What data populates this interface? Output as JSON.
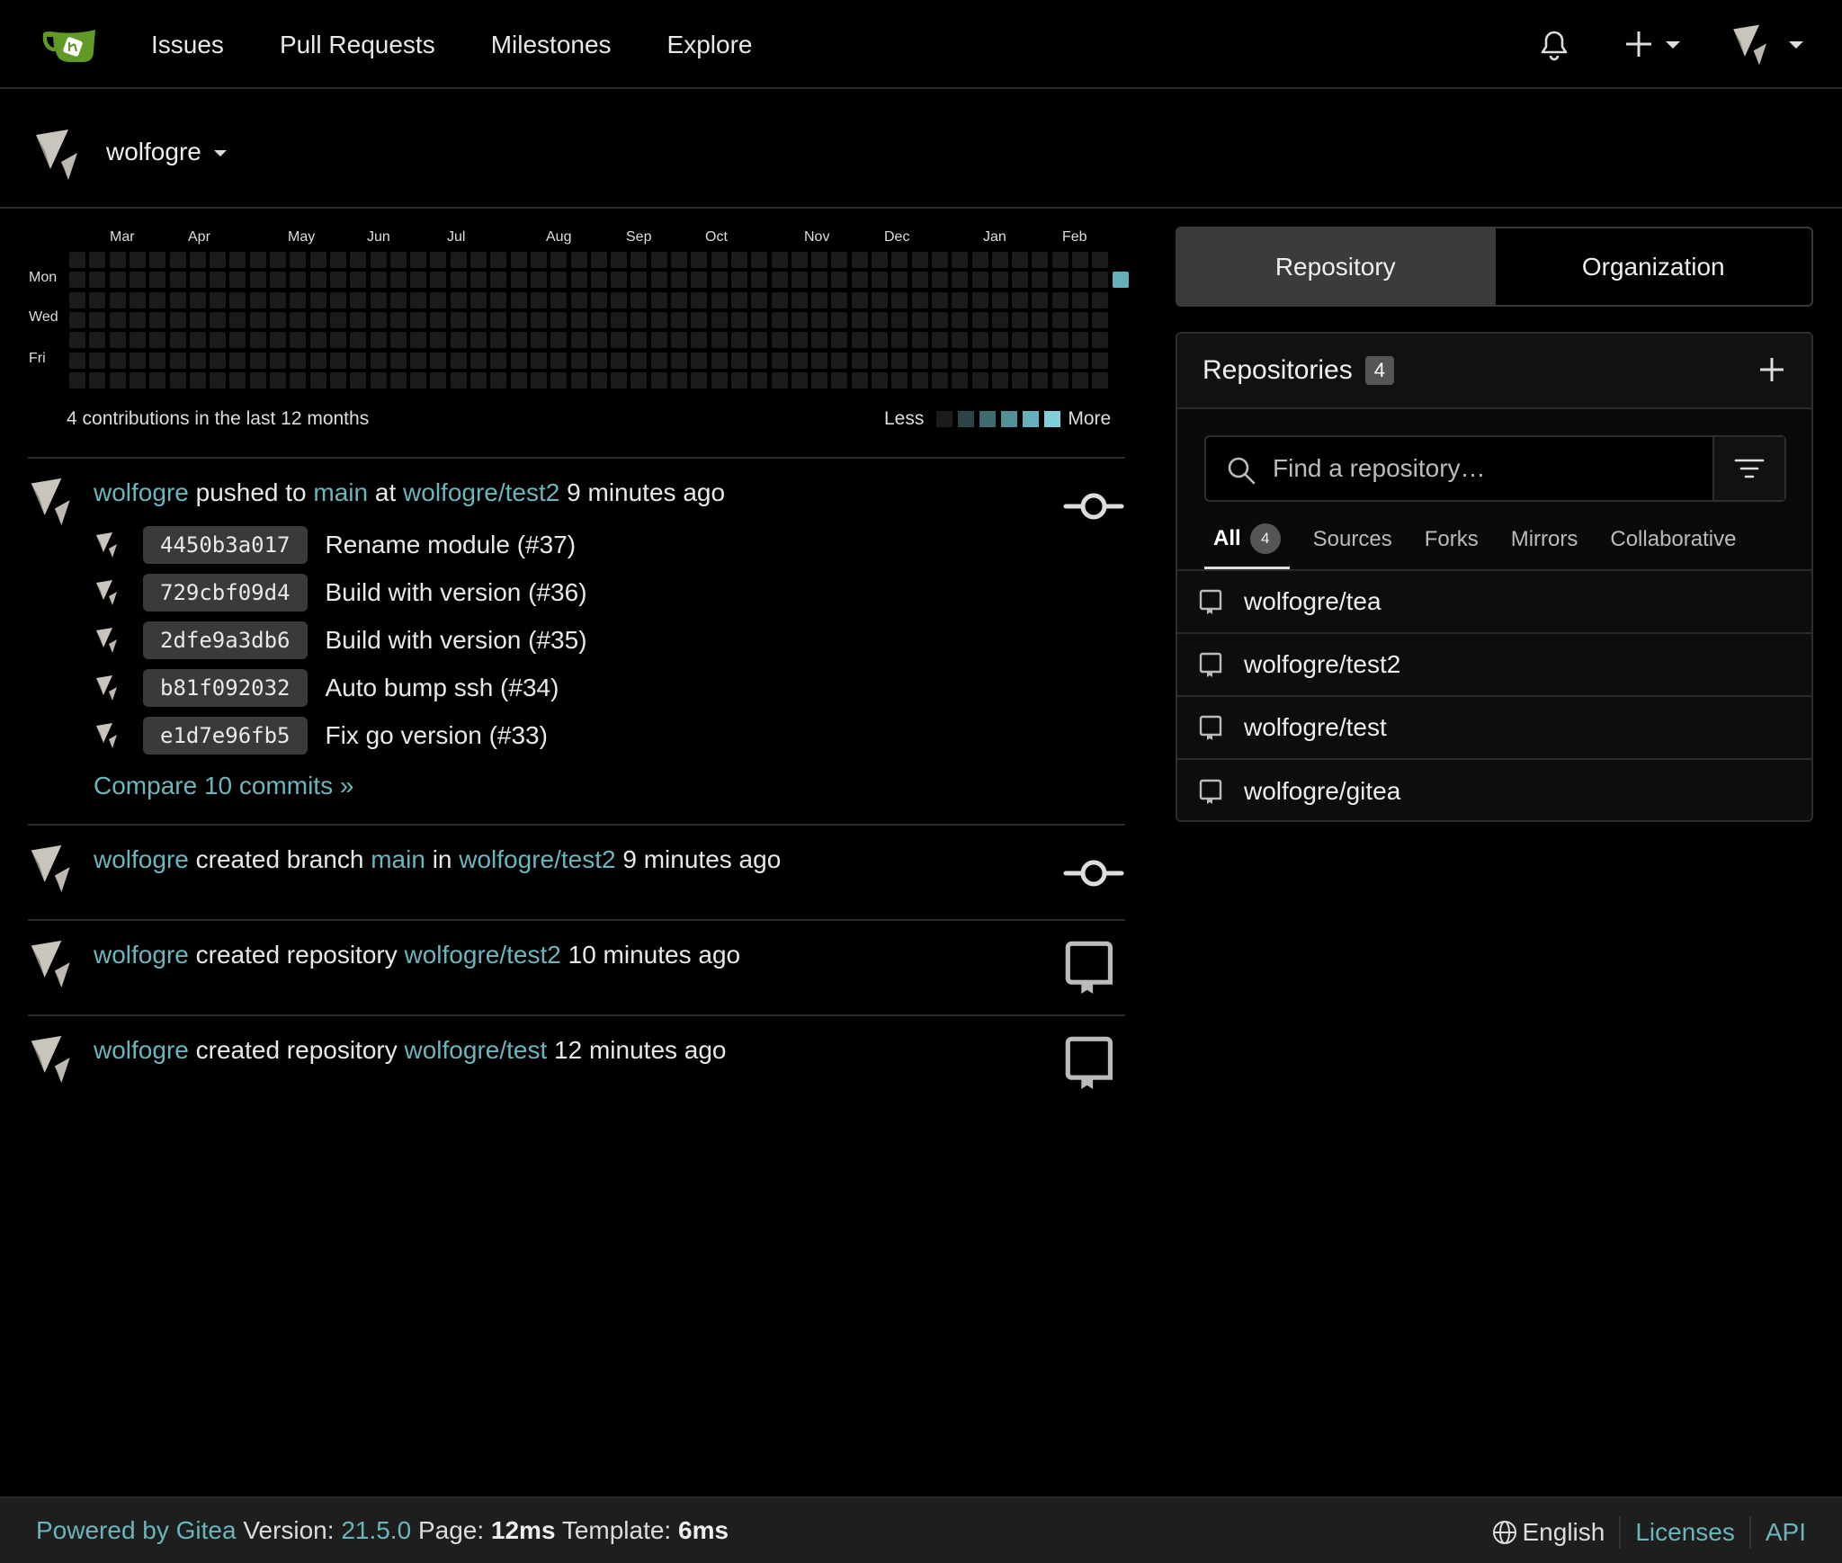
{
  "nav": {
    "links": [
      "Issues",
      "Pull Requests",
      "Milestones",
      "Explore"
    ]
  },
  "context": {
    "user": "wolfogre"
  },
  "heatmap": {
    "months": [
      "Mar",
      "Apr",
      "May",
      "Jun",
      "Jul",
      "Aug",
      "Sep",
      "Oct",
      "Nov",
      "Dec",
      "Jan",
      "Feb"
    ],
    "days": [
      "Mon",
      "Wed",
      "Fri"
    ],
    "summary": "4 contributions in the last 12 months",
    "less": "Less",
    "more": "More",
    "colors": [
      "#1b1b1b",
      "#2c4447",
      "#3f6a6f",
      "#529197",
      "#64b0b8",
      "#7fd0d8"
    ]
  },
  "feed": [
    {
      "user": "wolfogre",
      "verb": "pushed to",
      "ref": "main",
      "prep": "at",
      "repo": "wolfogre/test2",
      "time": "9 minutes ago",
      "icon": "git-commit-icon",
      "commits": [
        {
          "sha": "4450b3a017",
          "msg": "Rename module (#37)"
        },
        {
          "sha": "729cbf09d4",
          "msg": "Build with version (#36)"
        },
        {
          "sha": "2dfe9a3db6",
          "msg": "Build with version (#35)"
        },
        {
          "sha": "b81f092032",
          "msg": "Auto bump ssh (#34)"
        },
        {
          "sha": "e1d7e96fb5",
          "msg": "Fix go version (#33)"
        }
      ],
      "compare": "Compare 10 commits »"
    },
    {
      "user": "wolfogre",
      "verb": "created branch",
      "ref": "main",
      "prep": "in",
      "repo": "wolfogre/test2",
      "time": "9 minutes ago",
      "icon": "git-commit-icon"
    },
    {
      "user": "wolfogre",
      "verb": "created repository",
      "repo": "wolfogre/test2",
      "time": "10 minutes ago",
      "icon": "repo-icon"
    },
    {
      "user": "wolfogre",
      "verb": "created repository",
      "repo": "wolfogre/test",
      "time": "12 minutes ago",
      "icon": "repo-icon"
    }
  ],
  "switcher": {
    "repository": "Repository",
    "organization": "Organization"
  },
  "repos": {
    "title": "Repositories",
    "count": "4",
    "search_placeholder": "Find a repository…",
    "tabs": {
      "all": "All",
      "all_count": "4",
      "sources": "Sources",
      "forks": "Forks",
      "mirrors": "Mirrors",
      "collaborative": "Collaborative"
    },
    "items": [
      "wolfogre/tea",
      "wolfogre/test2",
      "wolfogre/test",
      "wolfogre/gitea"
    ]
  },
  "footer": {
    "powered": "Powered by Gitea",
    "version_label": "Version:",
    "version": "21.5.0",
    "page_label": "Page:",
    "page_time": "12ms",
    "template_label": "Template:",
    "template_time": "6ms",
    "language": "English",
    "licenses": "Licenses",
    "api": "API"
  }
}
